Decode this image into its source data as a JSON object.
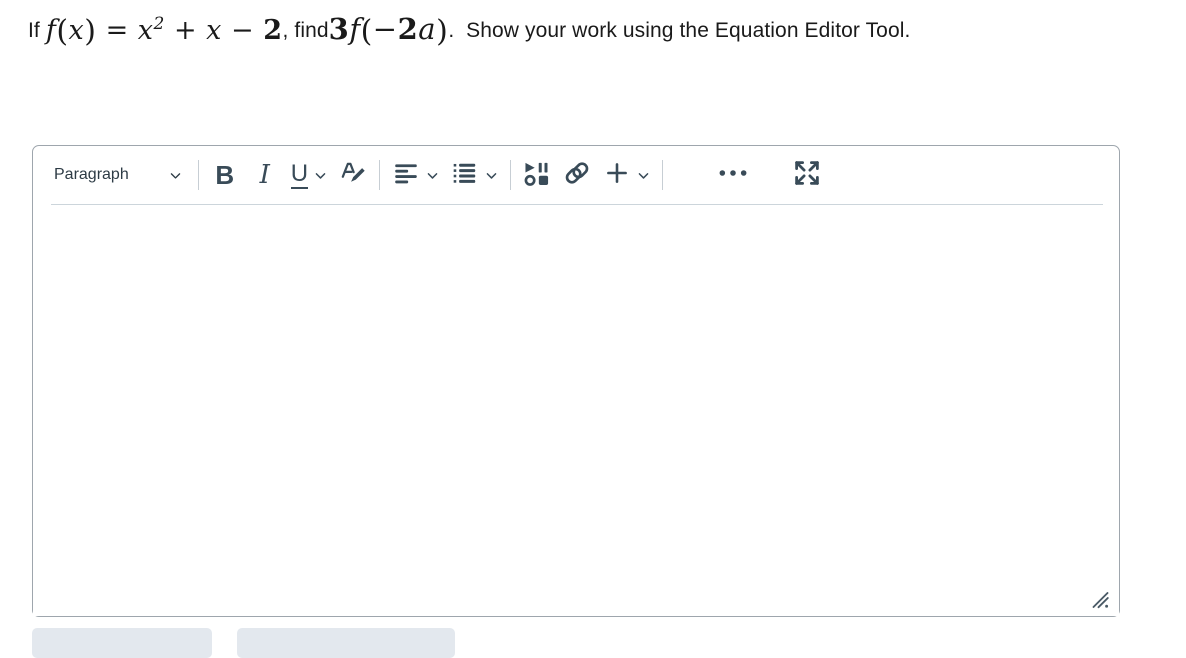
{
  "question": {
    "lead": "If ",
    "function_def": {
      "f": "f",
      "open": "(",
      "var": "x",
      "close": ")",
      "equals": "=",
      "term1_base": "x",
      "term1_exp": "2",
      "plus": "+",
      "term2": "x",
      "minus": "−",
      "term3": "2"
    },
    "comma": ", ",
    "find_word": "find",
    "expression": {
      "coefficient": "3",
      "f": "f",
      "open": "(",
      "minus": "−",
      "two": "2",
      "a": "a",
      "close": ")"
    },
    "period": ".",
    "tail": "Show your work using the Equation Editor Tool."
  },
  "editor": {
    "toolbar": {
      "paragraph_style": "Paragraph",
      "bold_label": "B",
      "italic_label": "I",
      "underline_label": "U",
      "buttons": [
        {
          "name": "paragraph-style-dropdown",
          "label": "Paragraph"
        },
        {
          "name": "bold-button",
          "label": "Bold"
        },
        {
          "name": "italic-button",
          "label": "Italic"
        },
        {
          "name": "underline-button",
          "label": "Underline"
        },
        {
          "name": "text-color-button",
          "label": "Text Color"
        },
        {
          "name": "align-button",
          "label": "Align"
        },
        {
          "name": "list-button",
          "label": "List"
        },
        {
          "name": "media-button",
          "label": "Insert Media"
        },
        {
          "name": "link-button",
          "label": "Insert Link"
        },
        {
          "name": "insert-button",
          "label": "Insert"
        },
        {
          "name": "more-options-button",
          "label": "More Options"
        },
        {
          "name": "fullscreen-button",
          "label": "Expand"
        }
      ]
    },
    "body_text": "",
    "body_placeholder": ""
  },
  "colors": {
    "icon": "#394b58",
    "border": "#9ea6ad",
    "rule": "#ccd5db",
    "ghost_button": "#e3e8ee",
    "text": "#1a1a1a"
  }
}
